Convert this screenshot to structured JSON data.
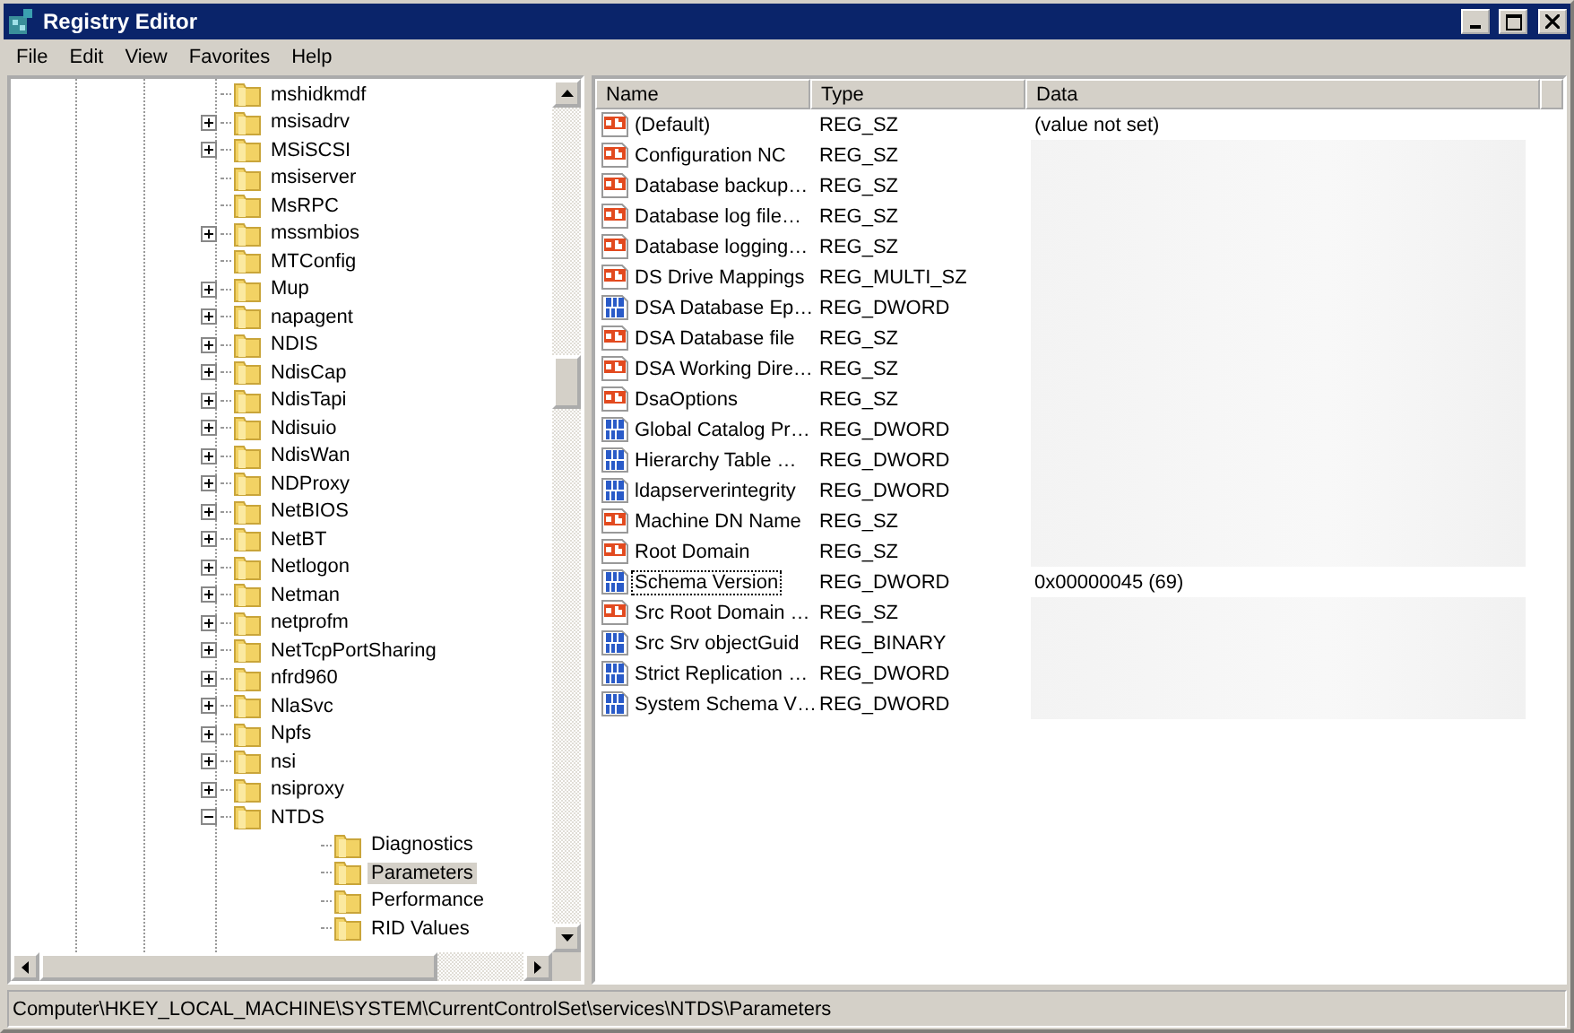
{
  "window": {
    "title": "Registry Editor"
  },
  "menu": [
    "File",
    "Edit",
    "View",
    "Favorites",
    "Help"
  ],
  "tree": [
    {
      "label": "mshidkmdf",
      "kind": "leaf",
      "selected": false
    },
    {
      "label": "msisadrv",
      "kind": "collapsed",
      "selected": false
    },
    {
      "label": "MSiSCSI",
      "kind": "collapsed",
      "selected": false
    },
    {
      "label": "msiserver",
      "kind": "leaf",
      "selected": false
    },
    {
      "label": "MsRPC",
      "kind": "leaf",
      "selected": false
    },
    {
      "label": "mssmbios",
      "kind": "collapsed",
      "selected": false
    },
    {
      "label": "MTConfig",
      "kind": "leaf",
      "selected": false
    },
    {
      "label": "Mup",
      "kind": "collapsed",
      "selected": false
    },
    {
      "label": "napagent",
      "kind": "collapsed",
      "selected": false
    },
    {
      "label": "NDIS",
      "kind": "collapsed",
      "selected": false
    },
    {
      "label": "NdisCap",
      "kind": "collapsed",
      "selected": false
    },
    {
      "label": "NdisTapi",
      "kind": "collapsed",
      "selected": false
    },
    {
      "label": "Ndisuio",
      "kind": "collapsed",
      "selected": false
    },
    {
      "label": "NdisWan",
      "kind": "collapsed",
      "selected": false
    },
    {
      "label": "NDProxy",
      "kind": "collapsed",
      "selected": false
    },
    {
      "label": "NetBIOS",
      "kind": "collapsed",
      "selected": false
    },
    {
      "label": "NetBT",
      "kind": "collapsed",
      "selected": false
    },
    {
      "label": "Netlogon",
      "kind": "collapsed",
      "selected": false
    },
    {
      "label": "Netman",
      "kind": "collapsed",
      "selected": false
    },
    {
      "label": "netprofm",
      "kind": "collapsed",
      "selected": false
    },
    {
      "label": "NetTcpPortSharing",
      "kind": "collapsed",
      "selected": false
    },
    {
      "label": "nfrd960",
      "kind": "collapsed",
      "selected": false
    },
    {
      "label": "NlaSvc",
      "kind": "collapsed",
      "selected": false
    },
    {
      "label": "Npfs",
      "kind": "collapsed",
      "selected": false
    },
    {
      "label": "nsi",
      "kind": "collapsed",
      "selected": false
    },
    {
      "label": "nsiproxy",
      "kind": "collapsed",
      "selected": false
    },
    {
      "label": "NTDS",
      "kind": "expanded",
      "selected": false,
      "children": [
        {
          "label": "Diagnostics",
          "kind": "leaf",
          "selected": false
        },
        {
          "label": "Parameters",
          "kind": "leaf",
          "selected": true
        },
        {
          "label": "Performance",
          "kind": "leaf",
          "selected": false
        },
        {
          "label": "RID Values",
          "kind": "leaf",
          "selected": false
        }
      ]
    }
  ],
  "table": {
    "columns": [
      "Name",
      "Type",
      "Data"
    ],
    "rows": [
      {
        "kind": "string",
        "name": "(Default)",
        "type": "REG_SZ",
        "data": "(value not set)",
        "redacted": false,
        "focused": false
      },
      {
        "kind": "string",
        "name": "Configuration NC",
        "type": "REG_SZ",
        "redacted": true,
        "focused": false
      },
      {
        "kind": "string",
        "name": "Database backup…",
        "type": "REG_SZ",
        "redacted": true,
        "focused": false
      },
      {
        "kind": "string",
        "name": "Database log file…",
        "type": "REG_SZ",
        "redacted": true,
        "focused": false
      },
      {
        "kind": "string",
        "name": "Database logging…",
        "type": "REG_SZ",
        "redacted": true,
        "focused": false
      },
      {
        "kind": "string",
        "name": "DS Drive Mappings",
        "type": "REG_MULTI_SZ",
        "redacted": true,
        "focused": false
      },
      {
        "kind": "binary",
        "name": "DSA Database Ep…",
        "type": "REG_DWORD",
        "redacted": true,
        "focused": false
      },
      {
        "kind": "string",
        "name": "DSA Database file",
        "type": "REG_SZ",
        "redacted": true,
        "focused": false
      },
      {
        "kind": "string",
        "name": "DSA Working Dire…",
        "type": "REG_SZ",
        "redacted": true,
        "focused": false
      },
      {
        "kind": "string",
        "name": "DsaOptions",
        "type": "REG_SZ",
        "redacted": true,
        "focused": false
      },
      {
        "kind": "binary",
        "name": "Global Catalog Pr…",
        "type": "REG_DWORD",
        "redacted": true,
        "focused": false
      },
      {
        "kind": "binary",
        "name": "Hierarchy Table …",
        "type": "REG_DWORD",
        "redacted": true,
        "focused": false
      },
      {
        "kind": "binary",
        "name": "ldapserverintegrity",
        "type": "REG_DWORD",
        "redacted": true,
        "focused": false
      },
      {
        "kind": "string",
        "name": "Machine DN Name",
        "type": "REG_SZ",
        "redacted": true,
        "focused": false
      },
      {
        "kind": "string",
        "name": "Root Domain",
        "type": "REG_SZ",
        "redacted": true,
        "focused": false
      },
      {
        "kind": "binary",
        "name": "Schema Version",
        "type": "REG_DWORD",
        "data": "0x00000045 (69)",
        "redacted": false,
        "focused": true
      },
      {
        "kind": "string",
        "name": "Src Root Domain …",
        "type": "REG_SZ",
        "redacted": true,
        "focused": false
      },
      {
        "kind": "binary",
        "name": "Src Srv objectGuid",
        "type": "REG_BINARY",
        "redacted": true,
        "focused": false
      },
      {
        "kind": "binary",
        "name": "Strict Replication …",
        "type": "REG_DWORD",
        "redacted": true,
        "focused": false
      },
      {
        "kind": "binary",
        "name": "System Schema V…",
        "type": "REG_DWORD",
        "redacted": true,
        "focused": false
      }
    ]
  },
  "status_bar": "Computer\\HKEY_LOCAL_MACHINE\\SYSTEM\\CurrentControlSet\\services\\NTDS\\Parameters"
}
